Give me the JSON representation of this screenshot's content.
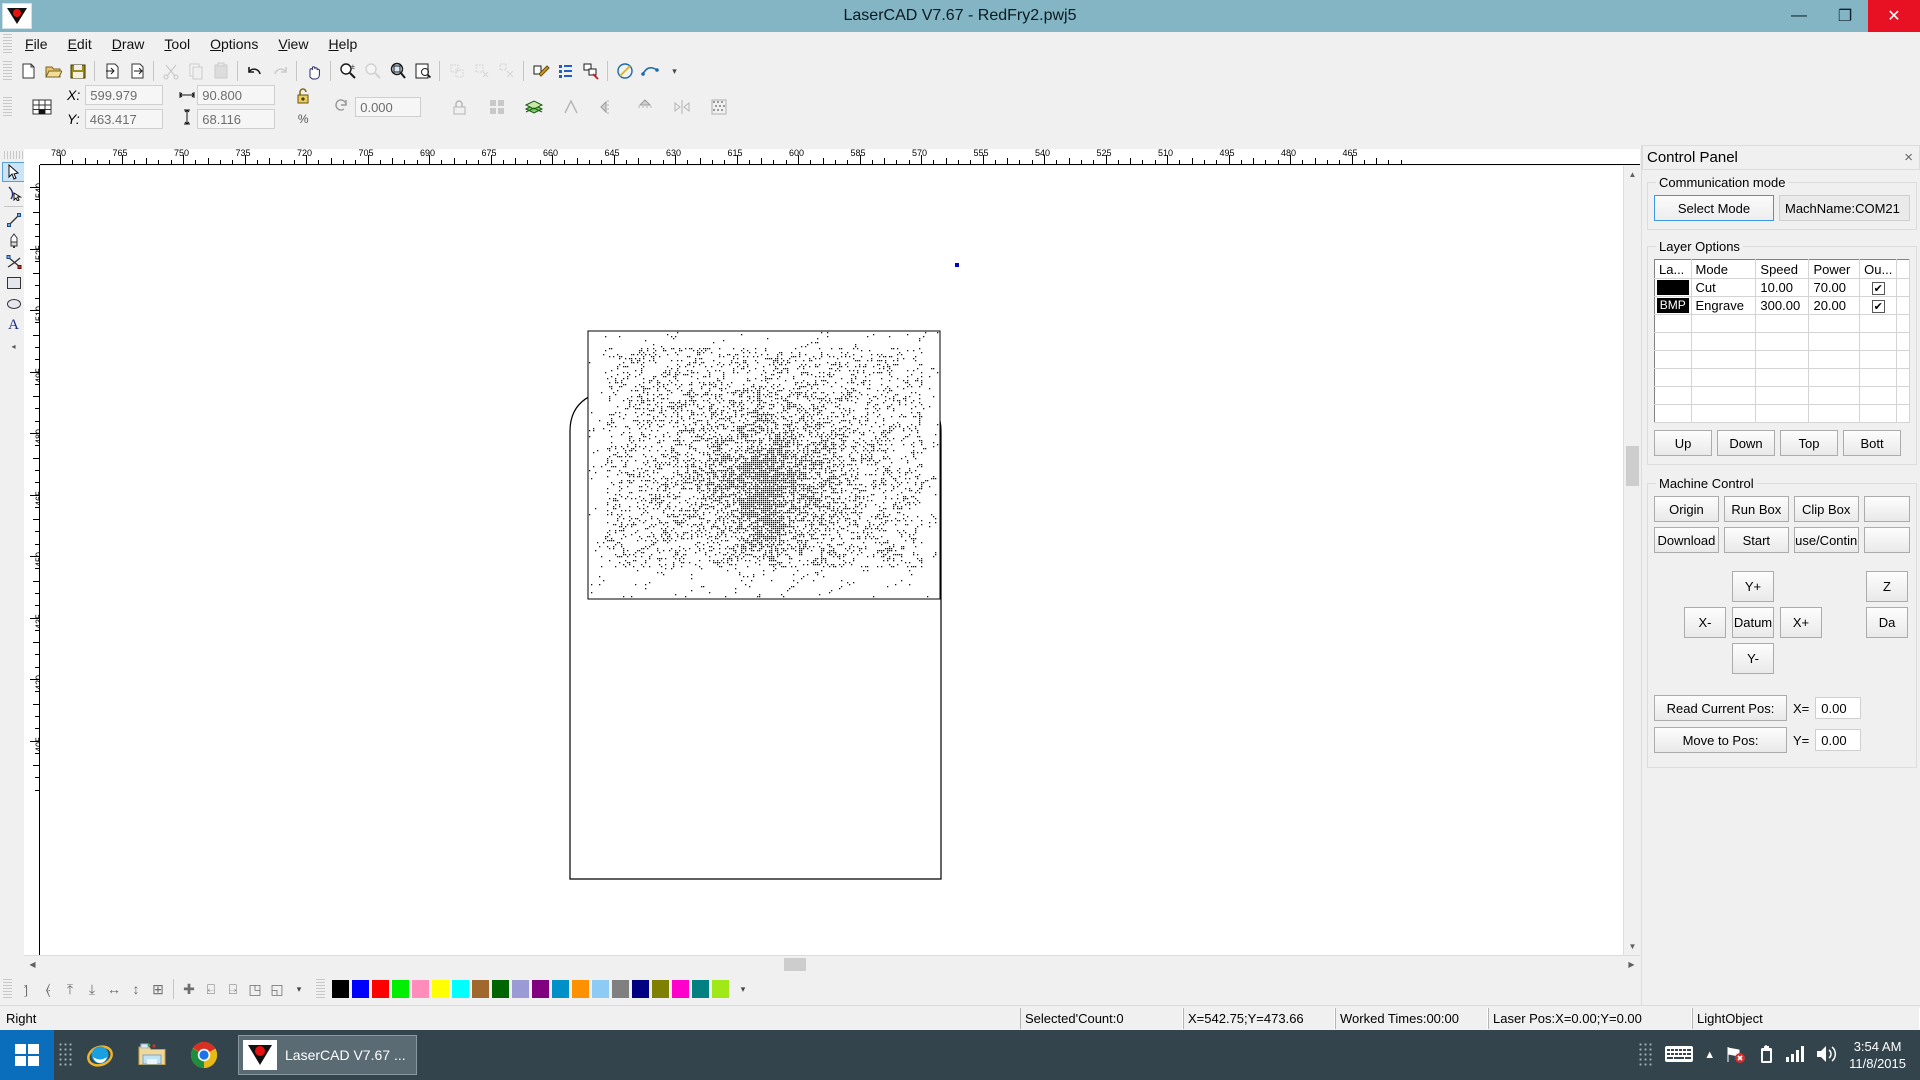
{
  "window": {
    "title": "LaserCAD V7.67 - RedFry2.pwj5",
    "app_icon": "lasercad-logo-icon",
    "minimize_label": "—",
    "restore_label": "❐",
    "close_label": "✕"
  },
  "menubar": {
    "items": [
      {
        "label": "File",
        "accel": "F"
      },
      {
        "label": "Edit",
        "accel": "E"
      },
      {
        "label": "Draw",
        "accel": "D"
      },
      {
        "label": "Tool",
        "accel": "T"
      },
      {
        "label": "Options",
        "accel": "O"
      },
      {
        "label": "View",
        "accel": "V"
      },
      {
        "label": "Help",
        "accel": "H"
      }
    ]
  },
  "toolbar": {
    "buttons": [
      {
        "name": "new-file-icon",
        "glyph": "🗋",
        "enabled": true
      },
      {
        "name": "open-file-icon",
        "glyph": "📂",
        "enabled": true
      },
      {
        "name": "save-file-icon",
        "glyph": "💾",
        "enabled": true
      },
      {
        "name": "import-icon",
        "glyph": "⮍",
        "enabled": true
      },
      {
        "name": "export-icon",
        "glyph": "⮎",
        "enabled": true
      },
      {
        "name": "cut-icon",
        "glyph": "✂",
        "enabled": false
      },
      {
        "name": "copy-icon",
        "glyph": "⧉",
        "enabled": false
      },
      {
        "name": "paste-icon",
        "glyph": "📋",
        "enabled": false
      },
      {
        "name": "undo-icon",
        "glyph": "↶",
        "enabled": true
      },
      {
        "name": "redo-icon",
        "glyph": "↷",
        "enabled": false
      },
      {
        "name": "pan-hand-icon",
        "glyph": "✋",
        "enabled": true
      },
      {
        "name": "zoom-in-out-icon",
        "glyph": "🔍",
        "enabled": true
      },
      {
        "name": "zoom-selection-icon",
        "glyph": "🔎",
        "enabled": false
      },
      {
        "name": "zoom-extents-icon",
        "glyph": "🔍",
        "enabled": true
      },
      {
        "name": "zoom-page-icon",
        "glyph": "❐",
        "enabled": true
      },
      {
        "name": "group-icon",
        "glyph": "❑",
        "enabled": false
      },
      {
        "name": "ungroup-icon",
        "glyph": "❐",
        "enabled": false
      },
      {
        "name": "ungroup-all-icon",
        "glyph": "❑",
        "enabled": false
      },
      {
        "name": "node-tool-icon",
        "glyph": "⚒",
        "enabled": true
      },
      {
        "name": "layer-list-icon",
        "glyph": "≡",
        "enabled": true
      },
      {
        "name": "array-copy-icon",
        "glyph": "⧉",
        "enabled": true
      },
      {
        "name": "curve-tool-icon",
        "glyph": "◔",
        "enabled": true
      },
      {
        "name": "path-optimize-icon",
        "glyph": "⎈",
        "enabled": true
      }
    ]
  },
  "properties": {
    "grid_anchor_icon": "anchor-grid-icon",
    "x_label": "X:",
    "x_value": "599.979",
    "y_label": "Y:",
    "y_value": "463.417",
    "width_icon": "width-arrows-icon",
    "width_value": "90.800",
    "height_icon": "height-arrows-icon",
    "height_value": "68.116",
    "lock_icon": "lock-open-icon",
    "percent_label": "%",
    "rotate_icon": "rotate-icon",
    "rotate_value": "0.000",
    "tools": [
      {
        "name": "unlock-scale-icon",
        "glyph": "⚿"
      },
      {
        "name": "array-icon",
        "glyph": "❑"
      },
      {
        "name": "layer-stack-icon",
        "glyph": "≣"
      },
      {
        "name": "mirror-corner-icon",
        "glyph": "◸"
      },
      {
        "name": "mirror-horizontal-icon",
        "glyph": "◧"
      },
      {
        "name": "mirror-vertical-icon",
        "glyph": "◩"
      },
      {
        "name": "flip-icon",
        "glyph": "⤨"
      },
      {
        "name": "dither-icon",
        "glyph": "░"
      }
    ]
  },
  "left_tools": [
    {
      "name": "select-arrow-tool",
      "glyph": "↖",
      "selected": true
    },
    {
      "name": "node-edit-tool",
      "glyph": "↰",
      "selected": false
    },
    {
      "name": "line-tool",
      "glyph": "╲",
      "selected": false
    },
    {
      "name": "pen-tool",
      "glyph": "✎",
      "selected": false
    },
    {
      "name": "bezier-curve-tool",
      "glyph": "⤳",
      "selected": false
    },
    {
      "name": "rectangle-tool",
      "glyph": "▭",
      "selected": false
    },
    {
      "name": "ellipse-tool",
      "glyph": "⬭",
      "selected": false
    },
    {
      "name": "text-tool",
      "glyph": "A",
      "selected": false
    }
  ],
  "ruler": {
    "h_labels": [
      "780",
      "765",
      "750",
      "735",
      "720",
      "705",
      "690",
      "675",
      "660",
      "645",
      "630",
      "615",
      "600",
      "585",
      "570",
      "555",
      "540",
      "525",
      "510",
      "495",
      "480",
      "465"
    ],
    "v_labels": [
      "540",
      "525",
      "510",
      "495",
      "480",
      "465",
      "450",
      "435",
      "420",
      "405"
    ],
    "unit_step": 15
  },
  "canvas": {
    "selected_point_color": "#0000d0",
    "artwork_outline_color": "#000000",
    "bmp_engrave_name": "engraved-bitmap-object",
    "cut_outline_name": "cut-outline-object"
  },
  "align_toolbar": {
    "buttons": [
      {
        "name": "align-left-icon",
        "glyph": "⦐"
      },
      {
        "name": "align-right-icon",
        "glyph": "⦑"
      },
      {
        "name": "align-top-icon",
        "glyph": "⤒"
      },
      {
        "name": "align-bottom-icon",
        "glyph": "⤓"
      },
      {
        "name": "align-center-horizontal-icon",
        "glyph": "↔"
      },
      {
        "name": "align-center-vertical-icon",
        "glyph": "↕"
      },
      {
        "name": "align-grid-icon",
        "glyph": "⊞"
      },
      {
        "name": "distribute-icon",
        "glyph": "✚"
      },
      {
        "name": "same-width-icon",
        "glyph": "⍇"
      },
      {
        "name": "same-height-icon",
        "glyph": "⍈"
      },
      {
        "name": "same-size-icon",
        "glyph": "◳"
      },
      {
        "name": "align-page-icon",
        "glyph": "◱"
      }
    ],
    "overflow_glyph": "▾"
  },
  "palette": {
    "colors": [
      "#000000",
      "#0000ff",
      "#ff0000",
      "#00ee00",
      "#ff8cbb",
      "#ffff00",
      "#00ffff",
      "#a0682c",
      "#006400",
      "#9a9ad4",
      "#800080",
      "#0090c8",
      "#ff9000",
      "#8ecbf4",
      "#808080",
      "#000080",
      "#808000",
      "#ff00cc",
      "#008080",
      "#a0e818"
    ],
    "overflow_glyph": "▾"
  },
  "statusbar": {
    "hint": "Right",
    "panes": [
      {
        "name": "selected-count-pane",
        "text": "Selected'Count:0"
      },
      {
        "name": "cursor-pos-pane",
        "text": "X=542.75;Y=473.66"
      },
      {
        "name": "worked-times-pane",
        "text": "Worked Times:00:00"
      },
      {
        "name": "laser-pos-pane",
        "text": "Laser Pos:X=0.00;Y=0.00"
      },
      {
        "name": "light-object-pane",
        "text": "LightObject"
      }
    ]
  },
  "control_panel": {
    "title": "Control Panel",
    "close_glyph": "×",
    "communication": {
      "group_label": "Communication mode",
      "select_mode_label": "Select Mode",
      "machine_name": "MachName:COM21"
    },
    "layer_options": {
      "group_label": "Layer Options",
      "columns": [
        "La...",
        "Mode",
        "Speed",
        "Power",
        "Ou..."
      ],
      "rows": [
        {
          "layer_chip": "",
          "chip_color": "#000000",
          "mode": "Cut",
          "speed": "10.00",
          "power": "70.00",
          "output": true
        },
        {
          "layer_chip": "BMP",
          "chip_color": "#000000",
          "mode": "Engrave",
          "speed": "300.00",
          "power": "20.00",
          "output": true
        }
      ],
      "empty_rows": 6,
      "order_buttons": [
        "Up",
        "Down",
        "Top",
        "Bott"
      ]
    },
    "machine_control": {
      "group_label": "Machine Control",
      "row1": [
        "Origin",
        "Run Box",
        "Clip Box"
      ],
      "row2": [
        "Download",
        "Start",
        "ause/Continu"
      ],
      "jog": {
        "up": "Y+",
        "left": "X-",
        "home": "Datum",
        "right": "X+",
        "down": "Y-"
      },
      "z_up": "Z",
      "z_datum": "Da",
      "read_pos_label": "Read Current Pos:",
      "move_pos_label": "Move to Pos:",
      "x_label": "X=",
      "x_value": "0.00",
      "y_label": "Y=",
      "y_value": "0.00"
    }
  },
  "taskbar": {
    "start_icon": "windows-start-icon",
    "apps": [
      {
        "name": "internet-explorer-icon"
      },
      {
        "name": "file-explorer-icon"
      },
      {
        "name": "google-chrome-icon"
      }
    ],
    "active_task": {
      "label": "LaserCAD V7.67 ...",
      "icon": "lasercad-logo-icon"
    },
    "tray": [
      {
        "name": "touch-keyboard-icon"
      },
      {
        "name": "show-hidden-icons-icon"
      },
      {
        "name": "network-disconnected-icon"
      },
      {
        "name": "battery-charging-icon"
      },
      {
        "name": "signal-bars-icon"
      },
      {
        "name": "volume-icon"
      }
    ],
    "clock_time": "3:54 AM",
    "clock_date": "11/8/2015"
  }
}
